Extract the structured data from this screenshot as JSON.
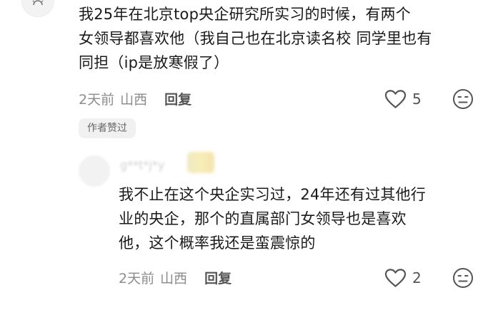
{
  "top_comment": {
    "lines": [
      "我25年在北京top央企研究所实习的时候，有两个",
      "女领导都喜欢他（我自己也在北京读名校 同学里也有",
      "同担（ip是放寒假了）"
    ],
    "time": "2天前",
    "location": "山西",
    "reply_label": "回复",
    "like_count": "5",
    "author_badge": "作者赞过"
  },
  "reply_comment": {
    "username": "g**t*j*y",
    "lines": [
      "我不止在这个央企实习过，24年还有过其他行",
      "业的央企，那个的直属部门女领导也是喜欢",
      "他，这个概率我还是蛮震惊的"
    ],
    "time": "2天前",
    "location": "山西",
    "reply_label": "回复",
    "like_count": "2"
  },
  "colors": {
    "text": "#1a1a1a",
    "meta": "#8c8c8c",
    "icon": "#555555",
    "badge_bg": "#f1f1f1"
  },
  "icons": [
    "sun-icon",
    "heart-icon",
    "dislike-face-icon"
  ]
}
